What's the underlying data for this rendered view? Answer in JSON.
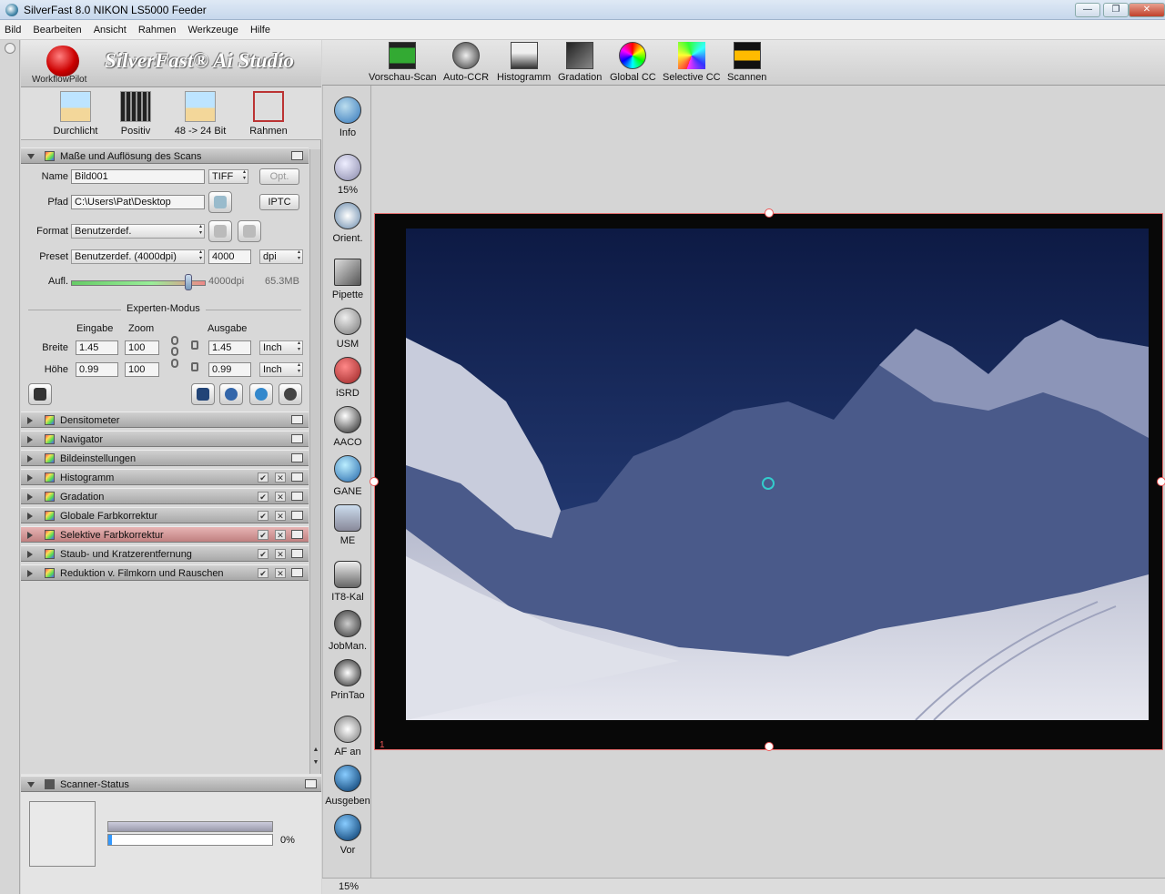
{
  "window": {
    "title": "SilverFast 8.0 NIKON LS5000 Feeder",
    "buttons": {
      "minimize": "—",
      "maximize": "❐",
      "close": "✕"
    }
  },
  "menu": [
    "Bild",
    "Bearbeiten",
    "Ansicht",
    "Rahmen",
    "Werkzeuge",
    "Hilfe"
  ],
  "brand": {
    "workflow": "WorkflowPilot",
    "app_name": "SilverFast® Ai Studio"
  },
  "quick": [
    {
      "label": "Durchlicht",
      "icon": "slide-icon"
    },
    {
      "label": "Positiv",
      "icon": "film-icon"
    },
    {
      "label": "48 -> 24 Bit",
      "icon": "bitdepth-icon"
    },
    {
      "label": "Rahmen",
      "icon": "frame-icon"
    }
  ],
  "scan_section": {
    "title": "Maße und Auflösung des Scans",
    "name_label": "Name",
    "name_value": "Bild001",
    "file_format": "TIFF",
    "opt_button": "Opt.",
    "path_label": "Pfad",
    "path_value": "C:\\Users\\Pat\\Desktop",
    "iptc_button": "IPTC",
    "format_label": "Format",
    "format_value": "Benutzerdef.",
    "preset_label": "Preset",
    "preset_value": "Benutzerdef. (4000dpi)",
    "dpi_value": "4000",
    "dpi_unit": "dpi",
    "resolution_label": "Aufl.",
    "resolution_value": "4000dpi",
    "file_size": "65.3MB",
    "resolution_slider_fraction": 0.87,
    "expert_mode": "Experten-Modus",
    "col_input": "Eingabe",
    "col_zoom": "Zoom",
    "col_output": "Ausgabe",
    "width_label": "Breite",
    "height_label": "Höhe",
    "width_in": "1.45",
    "width_zoom": "100",
    "width_out": "1.45",
    "width_unit": "Inch",
    "height_in": "0.99",
    "height_zoom": "100",
    "height_out": "0.99",
    "height_unit": "Inch"
  },
  "sections": [
    {
      "label": "Densitometer",
      "checks": false,
      "highlight": false
    },
    {
      "label": "Navigator",
      "checks": false,
      "highlight": false
    },
    {
      "label": "Bildeinstellungen",
      "checks": false,
      "highlight": false
    },
    {
      "label": "Histogramm",
      "checks": true,
      "highlight": false
    },
    {
      "label": "Gradation",
      "checks": true,
      "highlight": false
    },
    {
      "label": "Globale Farbkorrektur",
      "checks": true,
      "highlight": false
    },
    {
      "label": "Selektive Farbkorrektur",
      "checks": true,
      "highlight": true
    },
    {
      "label": "Staub- und Kratzerentfernung",
      "checks": true,
      "highlight": false
    },
    {
      "label": "Reduktion v. Filmkorn und Rauschen",
      "checks": true,
      "highlight": false
    }
  ],
  "scanner_status": {
    "title": "Scanner-Status",
    "progress_percent": "0%",
    "progress_fraction": 0.02
  },
  "top_tools": [
    "Vorschau-Scan",
    "Auto-CCR",
    "Histogramm",
    "Gradation",
    "Global CC",
    "Selective CC",
    "Scannen"
  ],
  "side_tools": [
    "Info",
    "15%",
    "Orient.",
    "Pipette",
    "USM",
    "iSRD",
    "AACO",
    "GANE",
    "ME",
    "IT8-Kal",
    "JobMan.",
    "PrinTao",
    "AF an",
    "Ausgeben",
    "Vor"
  ],
  "preview": {
    "frame_number": "1"
  },
  "bottom_zoom": "15%",
  "colors": {
    "accent_red": "#e87070",
    "highlight_section": "#d69a9a",
    "progress": "#3399ff"
  }
}
